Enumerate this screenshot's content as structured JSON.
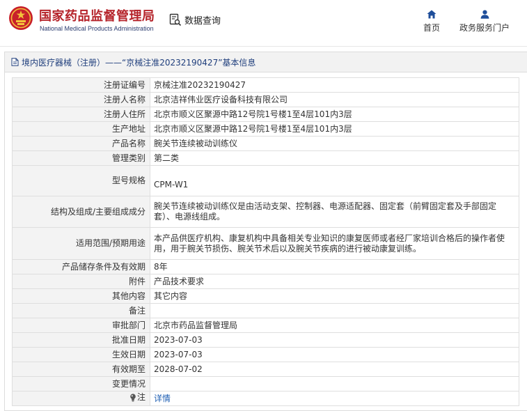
{
  "header": {
    "brand_cn": "国家药品监督管理局",
    "brand_en": "National Medical Products Administration",
    "search_label": "数据查询",
    "nav": [
      {
        "label": "首页",
        "icon": "home-icon"
      },
      {
        "label": "政务服务门户",
        "icon": "user-icon"
      }
    ],
    "colors": {
      "brand": "#b5232a",
      "nav_icon": "#1f4e9a",
      "link": "#1f5fb3",
      "panel_title": "#1f3e7c"
    }
  },
  "panel": {
    "title": "境内医疗器械（注册）——“京械注准20232190427”基本信息",
    "icon": "document-icon"
  },
  "records": [
    {
      "label": "注册证编号",
      "value": "京械注准20232190427"
    },
    {
      "label": "注册人名称",
      "value": "北京洁祥伟业医疗设备科技有限公司"
    },
    {
      "label": "注册人住所",
      "value": "北京市顺义区聚源中路12号院1号楼1至4层101内3层"
    },
    {
      "label": "生产地址",
      "value": "北京市顺义区聚源中路12号院1号楼1至4层101内3层"
    },
    {
      "label": "产品名称",
      "value": "腕关节连续被动训练仪"
    },
    {
      "label": "管理类别",
      "value": "第二类"
    },
    {
      "label": "型号规格",
      "value": "CPM-W1"
    },
    {
      "label": "结构及组成/主要组成成分",
      "value": "腕关节连续被动训练仪是由活动支架、控制器、电源适配器、固定套（前臂固定套及手部固定套）、电源线组成。"
    },
    {
      "label": "适用范围/预期用途",
      "value": "本产品供医疗机构、康复机构中具备相关专业知识的康复医师或者经厂家培训合格后的操作者使用，用于腕关节损伤、腕关节术后以及腕关节疾病的进行被动康复训练。"
    },
    {
      "label": "产品储存条件及有效期",
      "value": "8年"
    },
    {
      "label": "附件",
      "value": "产品技术要求"
    },
    {
      "label": "其他内容",
      "value": "其它内容"
    },
    {
      "label": "备注",
      "value": ""
    },
    {
      "label": "审批部门",
      "value": "北京市药品监督管理局"
    },
    {
      "label": "批准日期",
      "value": "2023-07-03"
    },
    {
      "label": "生效日期",
      "value": "2023-07-03"
    },
    {
      "label": "有效期至",
      "value": "2028-07-02"
    },
    {
      "label": "变更情况",
      "value": ""
    }
  ],
  "note_row": {
    "label": "注",
    "link": "详情",
    "icon": "lightbulb-icon"
  }
}
